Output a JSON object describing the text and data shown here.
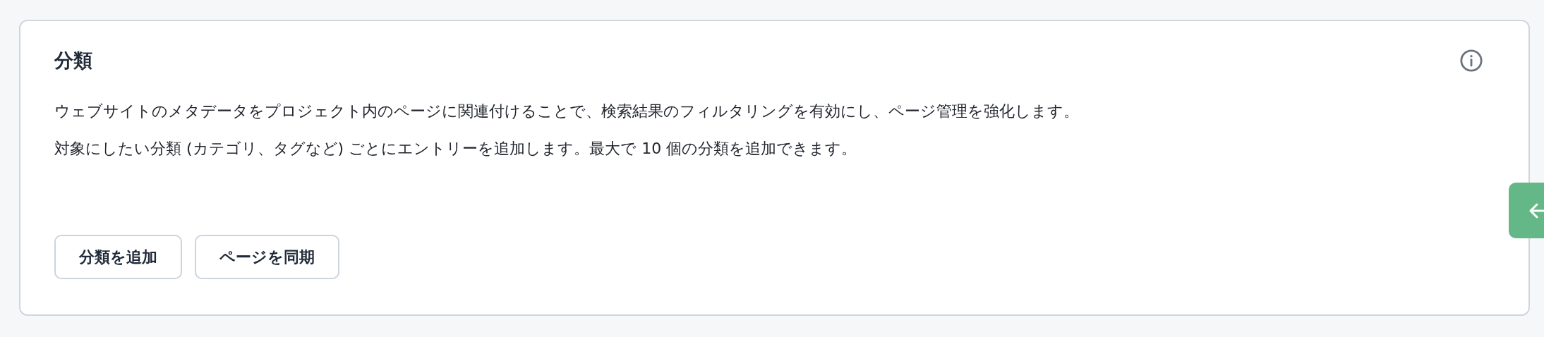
{
  "card": {
    "title": "分類",
    "paragraphs": [
      "ウェブサイトのメタデータをプロジェクト内のページに関連付けることで、検索結果のフィルタリングを有効にし、ページ管理を強化します。",
      "対象にしたい分類 (カテゴリ、タグなど) ごとにエントリーを追加します。最大で 10 個の分類を追加できます。"
    ],
    "buttons": [
      {
        "label": "分類を追加"
      },
      {
        "label": "ページを同期"
      }
    ]
  }
}
